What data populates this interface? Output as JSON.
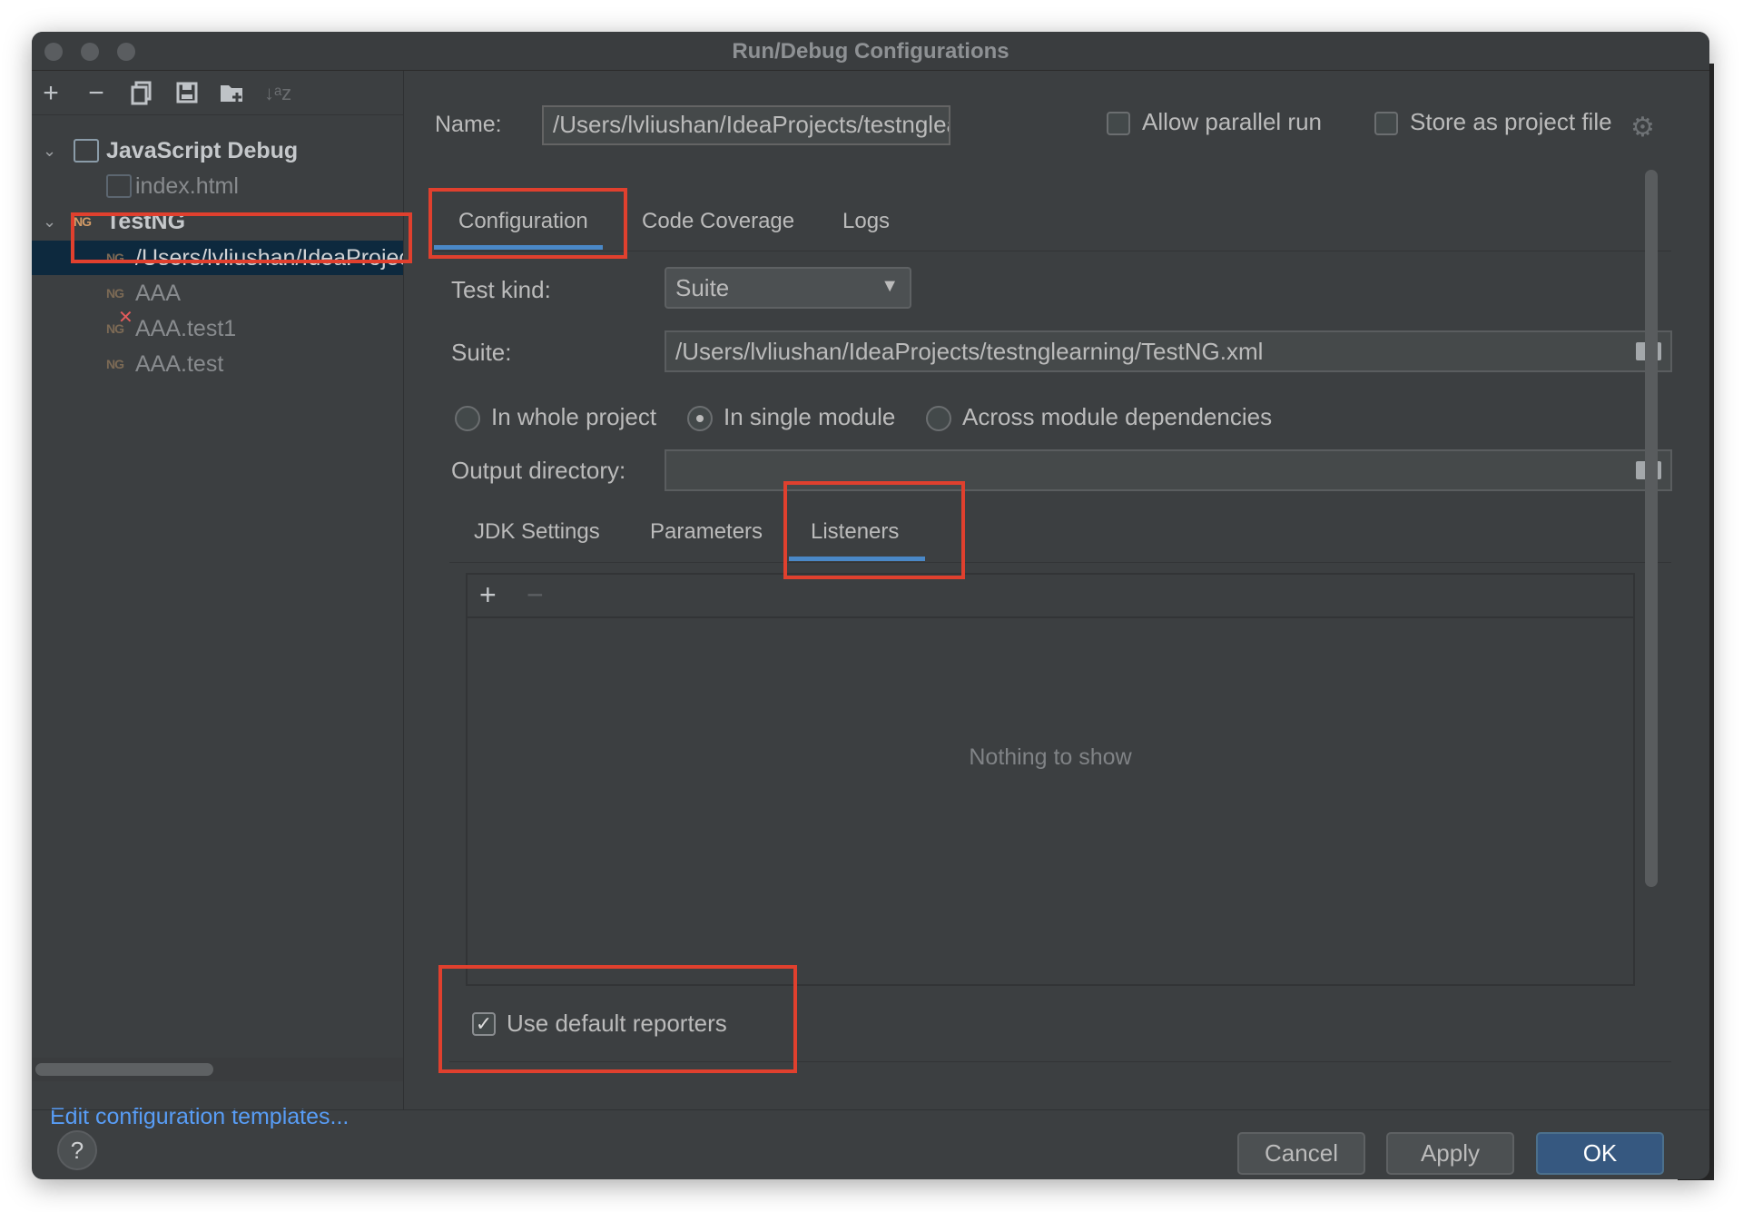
{
  "window": {
    "title": "Run/Debug Configurations"
  },
  "toolbar": {
    "add": "+",
    "remove": "−"
  },
  "tree": {
    "groups": [
      {
        "label": "JavaScript Debug",
        "children": [
          {
            "label": "index.html"
          }
        ]
      },
      {
        "label": "TestNG",
        "children": [
          {
            "label": "/Users/lvliushan/IdeaProjects/testnglearning/TestNG.xml",
            "selected": true
          },
          {
            "label": "AAA"
          },
          {
            "label": "AAA.test1"
          },
          {
            "label": "AAA.test"
          }
        ]
      }
    ]
  },
  "edit_templates_link": "Edit configuration templates...",
  "name": {
    "label": "Name:",
    "value": "/Users/lvliushan/IdeaProjects/testnglearning/TestNG.xml"
  },
  "options": {
    "allow_parallel": "Allow parallel run",
    "store_as_project_file": "Store as project file"
  },
  "tabs": [
    {
      "label": "Configuration",
      "active": true
    },
    {
      "label": "Code Coverage"
    },
    {
      "label": "Logs"
    }
  ],
  "test_kind": {
    "label": "Test kind:",
    "value": "Suite"
  },
  "suite": {
    "label": "Suite:",
    "value": "/Users/lvliushan/IdeaProjects/testnglearning/TestNG.xml"
  },
  "scope": [
    {
      "label": "In whole project",
      "selected": false
    },
    {
      "label": "In single module",
      "selected": true
    },
    {
      "label": "Across module dependencies",
      "selected": false
    }
  ],
  "output_dir": {
    "label": "Output directory:",
    "value": ""
  },
  "subtabs": [
    {
      "label": "JDK Settings"
    },
    {
      "label": "Parameters"
    },
    {
      "label": "Listeners",
      "active": true
    }
  ],
  "listeners": {
    "empty_text": "Nothing to show",
    "add": "+",
    "remove": "−"
  },
  "use_default_reporters": {
    "label": "Use default reporters",
    "checked": true
  },
  "buttons": {
    "help": "?",
    "cancel": "Cancel",
    "apply": "Apply",
    "ok": "OK"
  },
  "colors": {
    "window_bg": "#3c3f41",
    "accent": "#4a88c7",
    "link": "#589df6",
    "highlight": "#e0402e",
    "ok_bg": "#365880"
  }
}
